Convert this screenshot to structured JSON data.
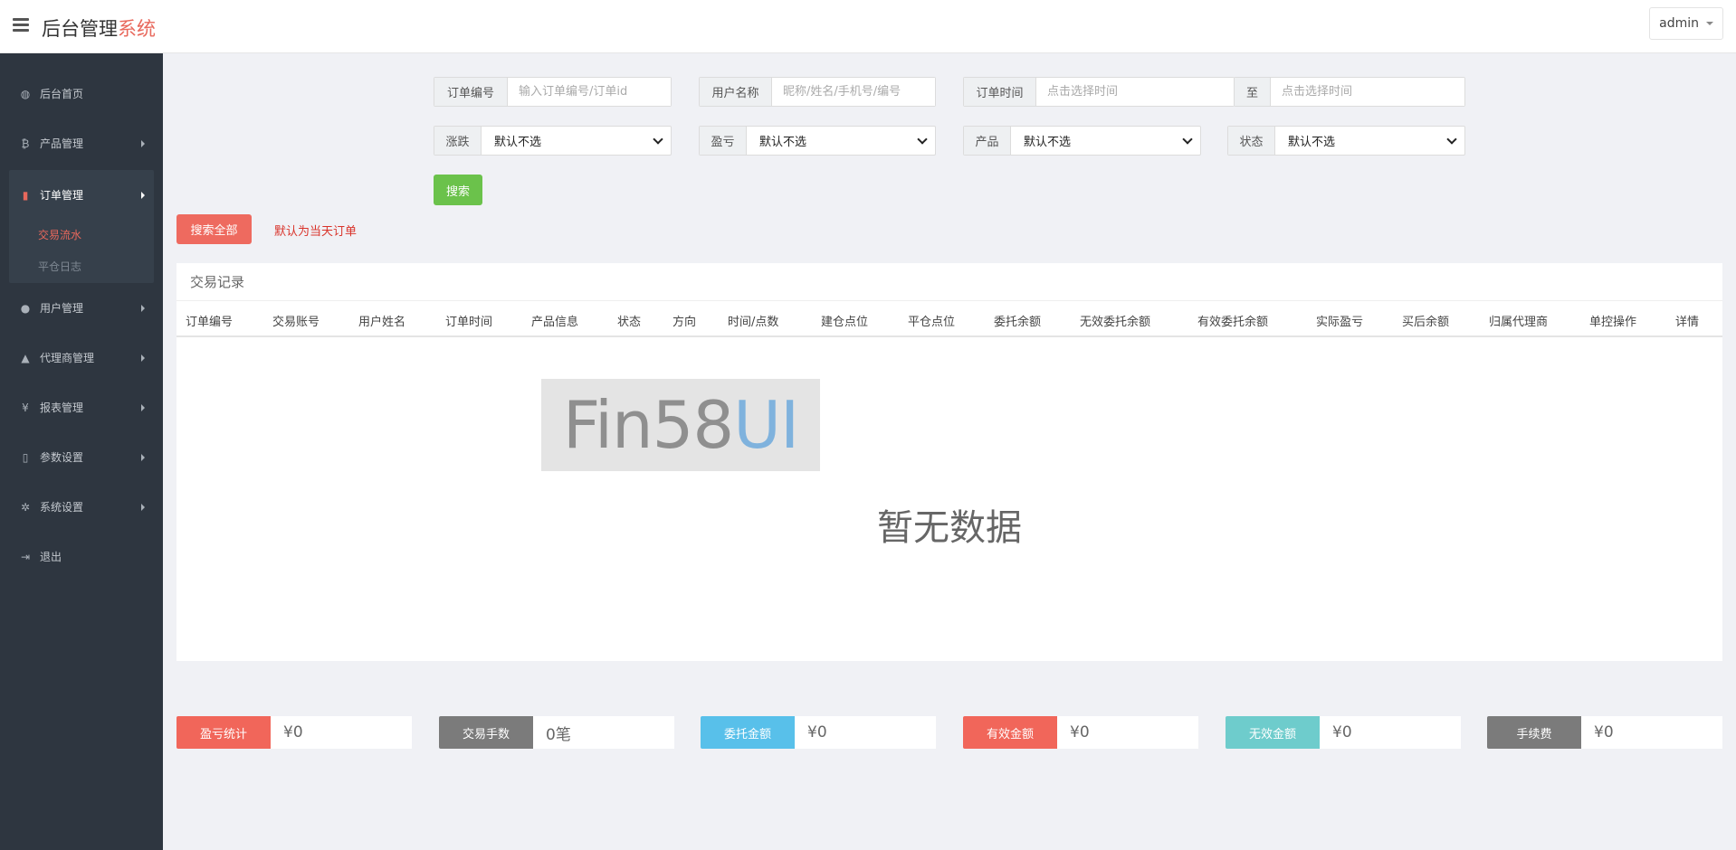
{
  "brand": {
    "title_main": "后台管理",
    "title_accent": "系统"
  },
  "user": {
    "name": "admin"
  },
  "sidebar": {
    "items": [
      {
        "key": "home",
        "icon": "dashboard-icon",
        "glyph": "◍",
        "label": "后台首页"
      },
      {
        "key": "products",
        "icon": "bitcoin-icon",
        "glyph": "₿",
        "label": "产品管理"
      },
      {
        "key": "orders",
        "icon": "orders-icon",
        "glyph": "▮",
        "label": "订单管理"
      },
      {
        "key": "users",
        "icon": "user-icon",
        "glyph": "●",
        "label": "用户管理"
      },
      {
        "key": "agents",
        "icon": "agent-icon",
        "glyph": "▲",
        "label": "代理商管理"
      },
      {
        "key": "reports",
        "icon": "yen-icon",
        "glyph": "¥",
        "label": "报表管理"
      },
      {
        "key": "params",
        "icon": "copy-icon",
        "glyph": "▯",
        "label": "参数设置"
      },
      {
        "key": "system",
        "icon": "gears-icon",
        "glyph": "✲",
        "label": "系统设置"
      },
      {
        "key": "logout",
        "icon": "sign-out-icon",
        "glyph": "⇥",
        "label": "退出"
      }
    ],
    "orders_sub": [
      {
        "label": "交易流水",
        "active": true
      },
      {
        "label": "平仓日志",
        "active": false
      }
    ]
  },
  "filters": {
    "order_no": {
      "label": "订单编号",
      "placeholder": "输入订单编号/订单id",
      "value": ""
    },
    "user_name": {
      "label": "用户名称",
      "placeholder": "昵称/姓名/手机号/编号",
      "value": ""
    },
    "order_time": {
      "label": "订单时间",
      "placeholder": "点击选择时间",
      "value": ""
    },
    "to_label": "至",
    "order_time_end": {
      "placeholder": "点击选择时间",
      "value": ""
    },
    "rise_fall": {
      "label": "涨跌",
      "value": "默认不选"
    },
    "profit_loss": {
      "label": "盈亏",
      "value": "默认不选"
    },
    "product": {
      "label": "产品",
      "value": "默认不选"
    },
    "status": {
      "label": "状态",
      "value": "默认不选"
    },
    "search_label": "搜索"
  },
  "actions": {
    "search_all_label": "搜索全部",
    "default_hint": "默认为当天订单"
  },
  "table": {
    "title": "交易记录",
    "columns": [
      "订单编号",
      "交易账号",
      "用户姓名",
      "订单时间",
      "产品信息",
      "状态",
      "方向",
      "时间/点数",
      "建仓点位",
      "平仓点位",
      "委托余额",
      "无效委托余额",
      "有效委托余额",
      "实际盈亏",
      "买后余额",
      "归属代理商",
      "单控操作",
      "详情"
    ],
    "watermark": {
      "main": "Fin58",
      "accent": "UI"
    },
    "empty_text": "暂无数据"
  },
  "stats": [
    {
      "label": "盈亏统计",
      "value": "¥0",
      "color": "#f1665a"
    },
    {
      "label": "交易手数",
      "value": "0笔",
      "color": "#7b7b7b"
    },
    {
      "label": "委托金额",
      "value": "¥0",
      "color": "#58c0ea"
    },
    {
      "label": "有效金额",
      "value": "¥0",
      "color": "#f1665a"
    },
    {
      "label": "无效金额",
      "value": "¥0",
      "color": "#6ecccc"
    },
    {
      "label": "手续费",
      "value": "¥0",
      "color": "#7b7b7b"
    }
  ],
  "colors": {
    "sidebar_bg": "#2e3640",
    "accent_red": "#e8685c",
    "search_green": "#6bc24b",
    "page_bg": "#f0f1f5"
  }
}
